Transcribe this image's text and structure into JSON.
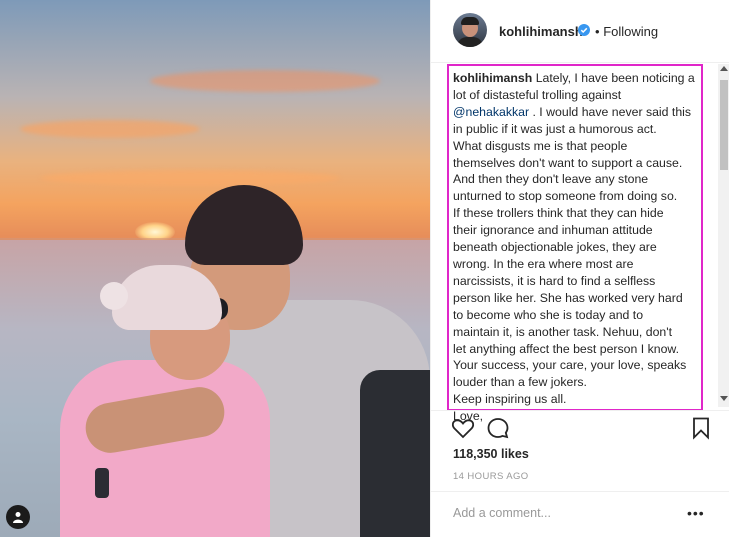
{
  "post": {
    "username": "kohlihimansh",
    "separator": "•",
    "follow_state": "Following",
    "caption": {
      "username": "kohlihimansh",
      "lines": [
        "Lately, I have been noticing a",
        "lot of distasteful trolling against",
        "@nehakakkar",
        " . I would have never said this",
        "in public if it was just a humorous act.",
        "What disgusts me is that people",
        "themselves don't want to support a cause.",
        "And then they don't leave any stone",
        "unturned to stop someone from doing so.",
        "If these trollers think that they can hide",
        "their ignorance and inhuman attitude",
        "beneath objectionable jokes, they are",
        "wrong. In the era where most are",
        "narcissists, it is hard to find a selfless",
        "person like her. She has worked very hard",
        "to become who she is today and to",
        "maintain it, is another task. Nehuu, don't",
        "let anything affect the best person I know.",
        "Your success, your care, your love, speaks",
        "louder than a few jokers.",
        "Keep inspiring us all.",
        "Love,"
      ]
    },
    "likes": "118,350 likes",
    "timestamp": "14 HOURS AGO",
    "comment_placeholder": "Add a comment...",
    "more_label": "•••"
  },
  "icons": {
    "verified": "verified-badge-icon",
    "like": "heart-icon",
    "comment": "comment-bubble-icon",
    "save": "bookmark-icon",
    "user_tag": "user-tag-icon"
  },
  "colors": {
    "verified_blue": "#3897f0",
    "highlight": "#e026c9",
    "mention": "#003569"
  }
}
